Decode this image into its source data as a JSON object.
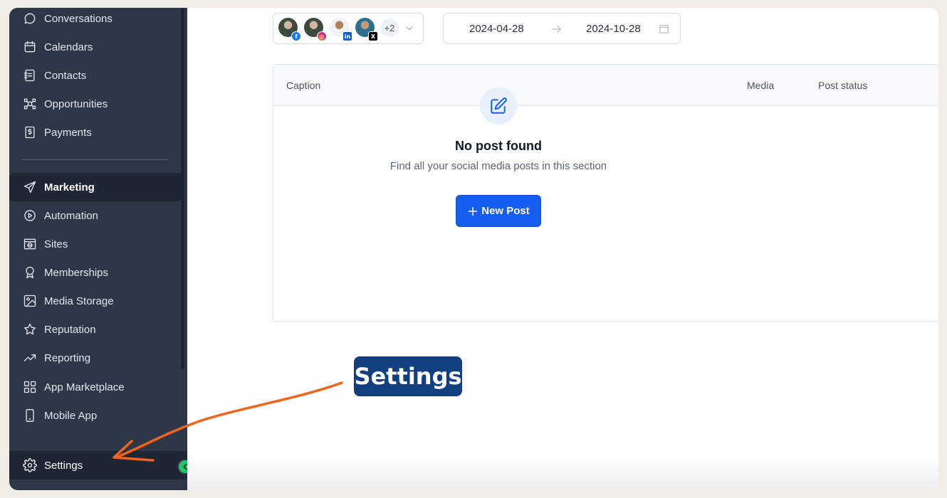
{
  "sidebar": {
    "items": [
      {
        "label": "Conversations",
        "icon": "chat-bubble-icon"
      },
      {
        "label": "Calendars",
        "icon": "calendar-icon"
      },
      {
        "label": "Contacts",
        "icon": "contacts-book-icon"
      },
      {
        "label": "Opportunities",
        "icon": "opportunities-icon"
      },
      {
        "label": "Payments",
        "icon": "payments-receipt-icon"
      },
      {
        "label": "Marketing",
        "icon": "send-icon",
        "active": true
      },
      {
        "label": "Automation",
        "icon": "play-circle-icon"
      },
      {
        "label": "Sites",
        "icon": "globe-window-icon"
      },
      {
        "label": "Memberships",
        "icon": "award-icon"
      },
      {
        "label": "Media Storage",
        "icon": "image-icon"
      },
      {
        "label": "Reputation",
        "icon": "star-icon"
      },
      {
        "label": "Reporting",
        "icon": "trending-up-icon"
      },
      {
        "label": "App Marketplace",
        "icon": "grid-icon"
      },
      {
        "label": "Mobile App",
        "icon": "mobile-icon"
      }
    ],
    "settings_label": "Settings"
  },
  "filters": {
    "accounts_more": "+2",
    "date_start": "2024-04-28",
    "date_end": "2024-10-28"
  },
  "table": {
    "columns": [
      "Caption",
      "Media",
      "Post status"
    ],
    "empty_title": "No post found",
    "empty_subtitle": "Find all your social media posts in this section",
    "new_post_label": "New Post"
  },
  "callout": {
    "label": "Settings"
  },
  "colors": {
    "sidebar_bg": "#2e3747",
    "primary": "#155eef",
    "callout_bg": "#12407e",
    "arrow": "#f26419",
    "collapse": "#22c55e"
  }
}
